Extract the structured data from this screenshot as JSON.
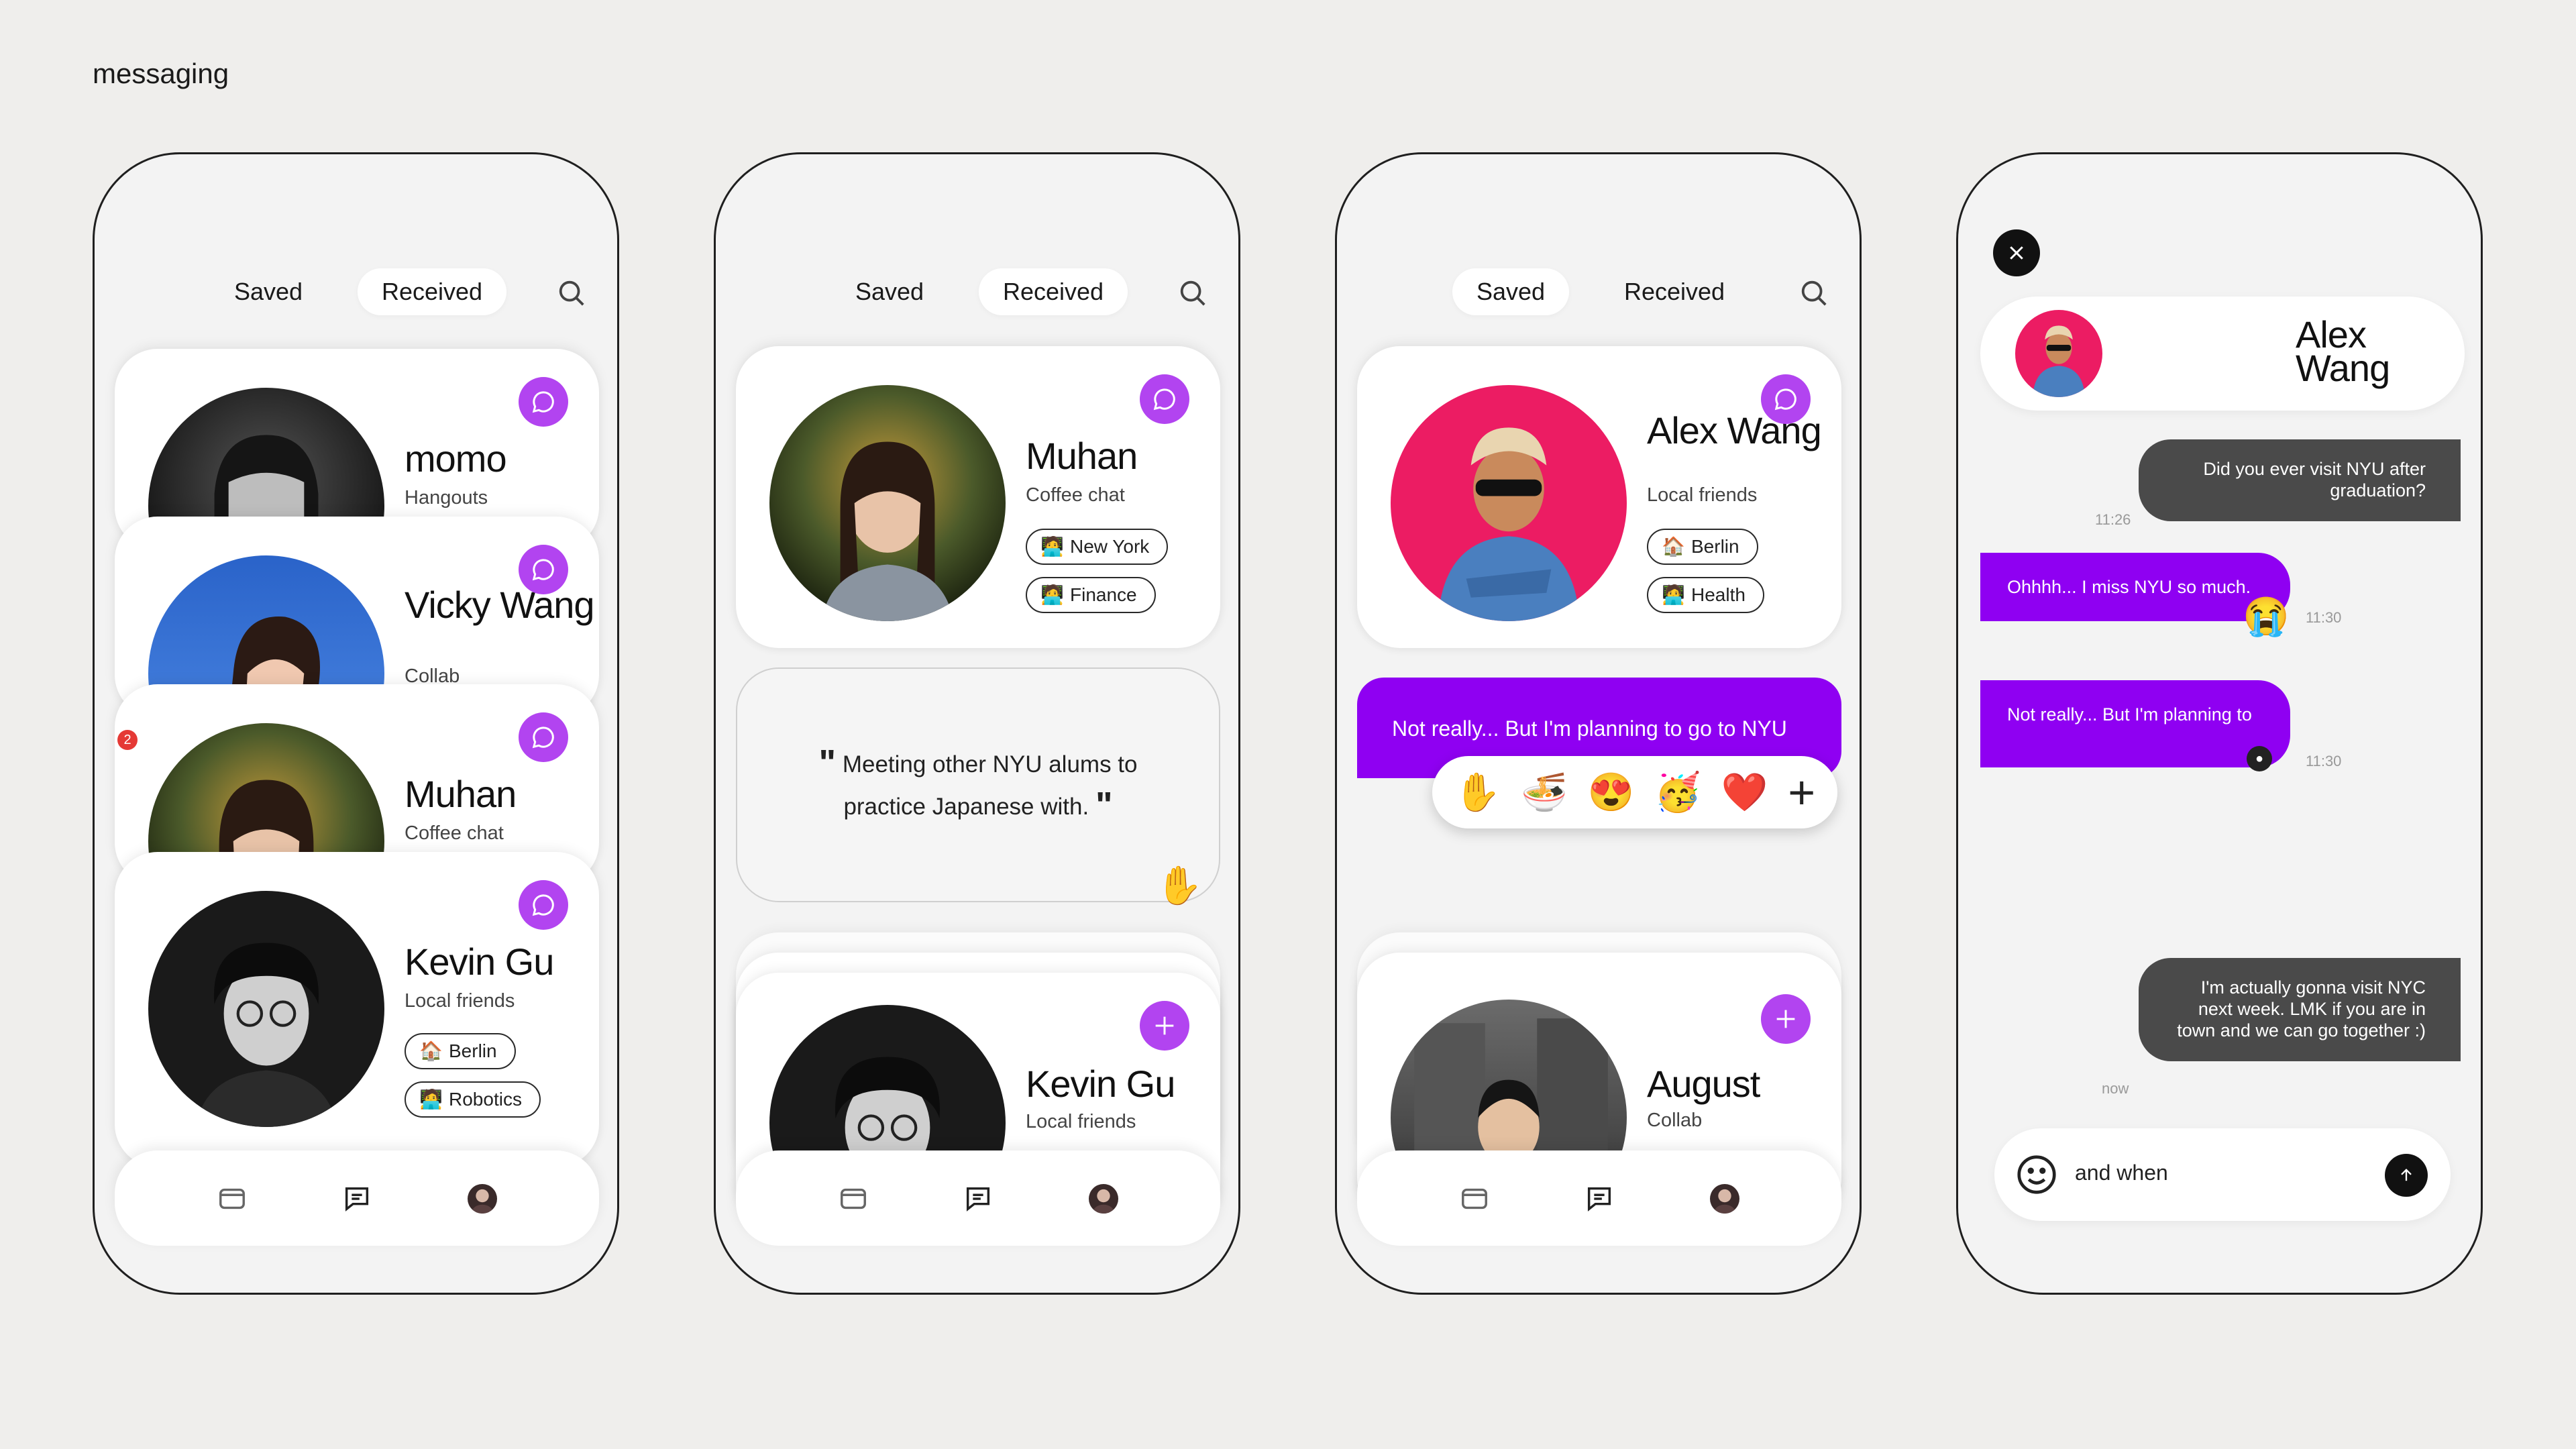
{
  "page": {
    "title": "messaging"
  },
  "tabs": {
    "saved": "Saved",
    "received": "Received"
  },
  "colors": {
    "accent": "#b244f0",
    "bubble_purple": "#8f00f2",
    "bubble_dark": "#4a4a4a",
    "background": "#efeeec"
  },
  "phone1": {
    "active_tab": "received",
    "cards": [
      {
        "name": "momo",
        "subtitle": "Hangouts"
      },
      {
        "name": "Vicky Wang",
        "subtitle": "Collab"
      },
      {
        "name": "Muhan",
        "subtitle": "Coffee chat",
        "badge": "2"
      },
      {
        "name": "Kevin Gu",
        "subtitle": "Local friends",
        "tags": [
          {
            "icon": "house-icon",
            "label": "Berlin"
          },
          {
            "icon": "technologist-icon",
            "label": "Robotics"
          }
        ]
      }
    ]
  },
  "phone2": {
    "active_tab": "received",
    "profile": {
      "name": "Muhan",
      "subtitle": "Coffee chat",
      "tags": [
        {
          "icon": "technologist-icon",
          "label": "New York"
        },
        {
          "icon": "technologist-icon",
          "label": "Finance"
        }
      ]
    },
    "quote": "Meeting other NYU alums to practice Japanese with.",
    "quote_reaction": "✋",
    "next": {
      "name": "Kevin Gu",
      "subtitle": "Local friends"
    }
  },
  "phone3": {
    "active_tab": "saved",
    "profile": {
      "name": "Alex Wang",
      "subtitle": "Local friends",
      "tags": [
        {
          "icon": "house-icon",
          "label": "Berlin"
        },
        {
          "icon": "technologist-icon",
          "label": "Health"
        }
      ]
    },
    "draft_message": "Not really... But I'm planning to go to NYU",
    "reactions": [
      "✋",
      "🍜",
      "😍",
      "🥳",
      "❤️",
      "+"
    ],
    "next": {
      "name": "August",
      "subtitle": "Collab"
    }
  },
  "phone4": {
    "contact_name": "Alex Wang",
    "messages": [
      {
        "side": "out",
        "text": "Did you ever visit NYU after graduation?",
        "time": "11:26"
      },
      {
        "side": "in",
        "text": "Ohhhh... I miss NYU so much.",
        "time": "11:30",
        "reaction": "😭"
      },
      {
        "side": "in",
        "text": "Not really... But I'm planning to",
        "time": "11:30"
      },
      {
        "side": "out",
        "text": "I'm actually gonna visit NYC next week. LMK if you are in town and we can go together :)",
        "time": "now"
      }
    ],
    "composer_value": "and when"
  }
}
